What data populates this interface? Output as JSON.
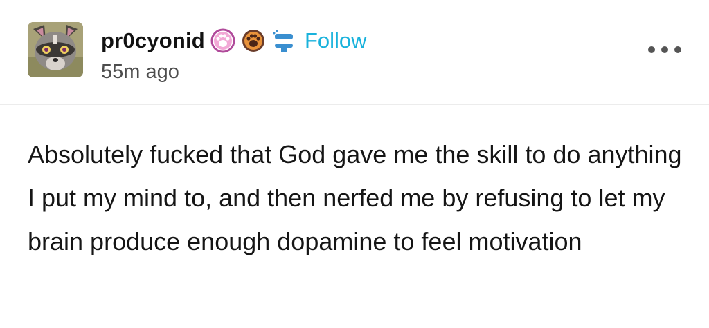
{
  "post": {
    "author": {
      "username": "pr0cyonid",
      "avatar_icon": "raccoon-avatar-icon",
      "badges": [
        "pink-paw-badge-icon",
        "orange-paw-badge-icon",
        "blue-chattering-teeth-badge-icon"
      ]
    },
    "follow_label": "Follow",
    "timestamp": "55m ago",
    "more_icon": "more-options-icon",
    "body_text": "Absolutely fucked that God gave me the skill to do anything I put my mind to, and then nerfed me by refusing to let my brain produce enough dopamine to feel motivation"
  },
  "colors": {
    "follow": "#19b2dc",
    "username": "#121212",
    "timestamp": "#4d4d4d",
    "divider": "#ececec"
  }
}
